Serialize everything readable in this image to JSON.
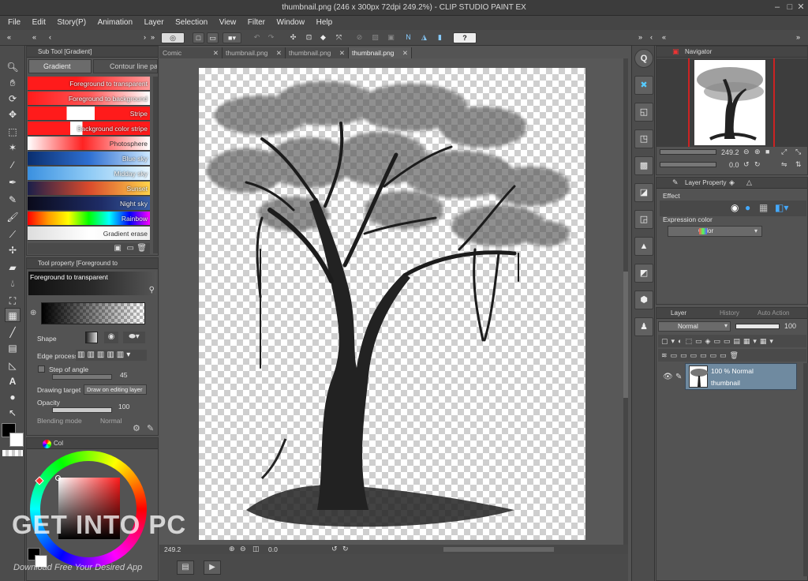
{
  "window": {
    "title": "thumbnail.png (246 x 300px 72dpi 249.2%) - CLIP STUDIO PAINT EX",
    "minimize": "–",
    "maximize": "□",
    "close": "✕"
  },
  "menu": [
    "File",
    "Edit",
    "Story(P)",
    "Animation",
    "Layer",
    "Selection",
    "View",
    "Filter",
    "Window",
    "Help"
  ],
  "tabs": [
    {
      "label": "Comic"
    },
    {
      "label": "thumbnail.png"
    },
    {
      "label": "thumbnail.png"
    },
    {
      "label": "thumbnail.png"
    }
  ],
  "subtool": {
    "header": "Sub Tool [Gradient]",
    "tab_gradient": "Gradient",
    "tab_contour": "Contour line pa",
    "gradients": [
      {
        "label": "Foreground to transparent"
      },
      {
        "label": "Foreground to background"
      },
      {
        "label": "Stripe"
      },
      {
        "label": "Background color stripe"
      },
      {
        "label": "Photosphere"
      },
      {
        "label": "Blue sky"
      },
      {
        "label": "Midday sky"
      },
      {
        "label": "Sunset"
      },
      {
        "label": "Night sky"
      },
      {
        "label": "Rainbow"
      },
      {
        "label": "Gradient erase"
      }
    ]
  },
  "toolprop": {
    "header": "Tool property [Foreground to",
    "name": "Foreground to transparent",
    "shape_label": "Shape",
    "edge_label": "Edge process",
    "step_label": "Step of angle",
    "step_value": "45",
    "target_label": "Drawing target",
    "target_value": "Draw on editing layer",
    "opacity_label": "Opacity",
    "opacity_value": "100",
    "blending_label": "Blending mode",
    "blending_value": "Normal"
  },
  "color": {
    "header": "Col"
  },
  "navigator": {
    "header": "Navigator",
    "zoom": "249.2",
    "rotation": "0.0"
  },
  "layer_property": {
    "header": "Layer Property",
    "effect_label": "Effect",
    "expression_label": "Expression color",
    "expression_value": "Color"
  },
  "layers": {
    "tab_layer": "Layer",
    "tab_history": "History",
    "tab_auto": "Auto Action",
    "blend_mode": "Normal",
    "opacity": "100",
    "items": [
      {
        "mode": "100 % Normal",
        "name": "thumbnail"
      }
    ]
  },
  "status": {
    "zoom": "249.2",
    "angle": "0.0"
  },
  "watermark": {
    "main": "GET INTO PC",
    "sub": "Download Free Your Desired App"
  }
}
